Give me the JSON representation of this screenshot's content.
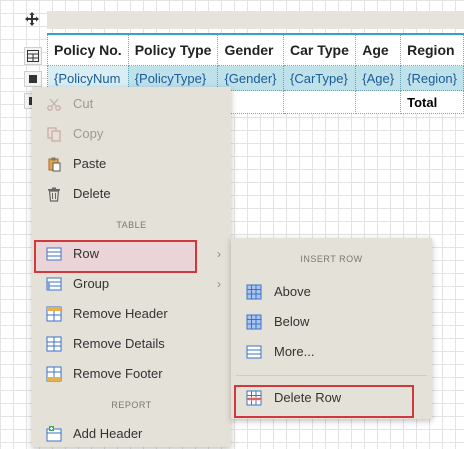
{
  "table": {
    "headers": [
      "Policy No.",
      "Policy Type",
      "Gender",
      "Car Type",
      "Age",
      "Region"
    ],
    "details": [
      "{PolicyNum",
      "{PolicyType}",
      "{Gender}",
      "{CarType}",
      "{Age}",
      "{Region}"
    ],
    "footer_label": "Total"
  },
  "context_menu": {
    "cut": "Cut",
    "copy": "Copy",
    "paste": "Paste",
    "delete": "Delete",
    "section_table": "TABLE",
    "row": "Row",
    "group": "Group",
    "remove_header": "Remove Header",
    "remove_details": "Remove Details",
    "remove_footer": "Remove Footer",
    "section_report": "REPORT",
    "add_header": "Add Header",
    "submenu_arrow": "›"
  },
  "submenu": {
    "title": "INSERT ROW",
    "above": "Above",
    "below": "Below",
    "more": "More...",
    "delete_row": "Delete Row"
  },
  "icons": [
    "move-icon",
    "table-icon",
    "scissors-icon",
    "copy-icon",
    "paste-icon",
    "trash-icon",
    "rows-icon",
    "grid-icon"
  ],
  "colors": {
    "highlight_border": "#d0383b",
    "detail_row_bg": "#bfe1ea",
    "menu_bg": "#e4e1d8",
    "icon_blue": "#3b73c6"
  }
}
